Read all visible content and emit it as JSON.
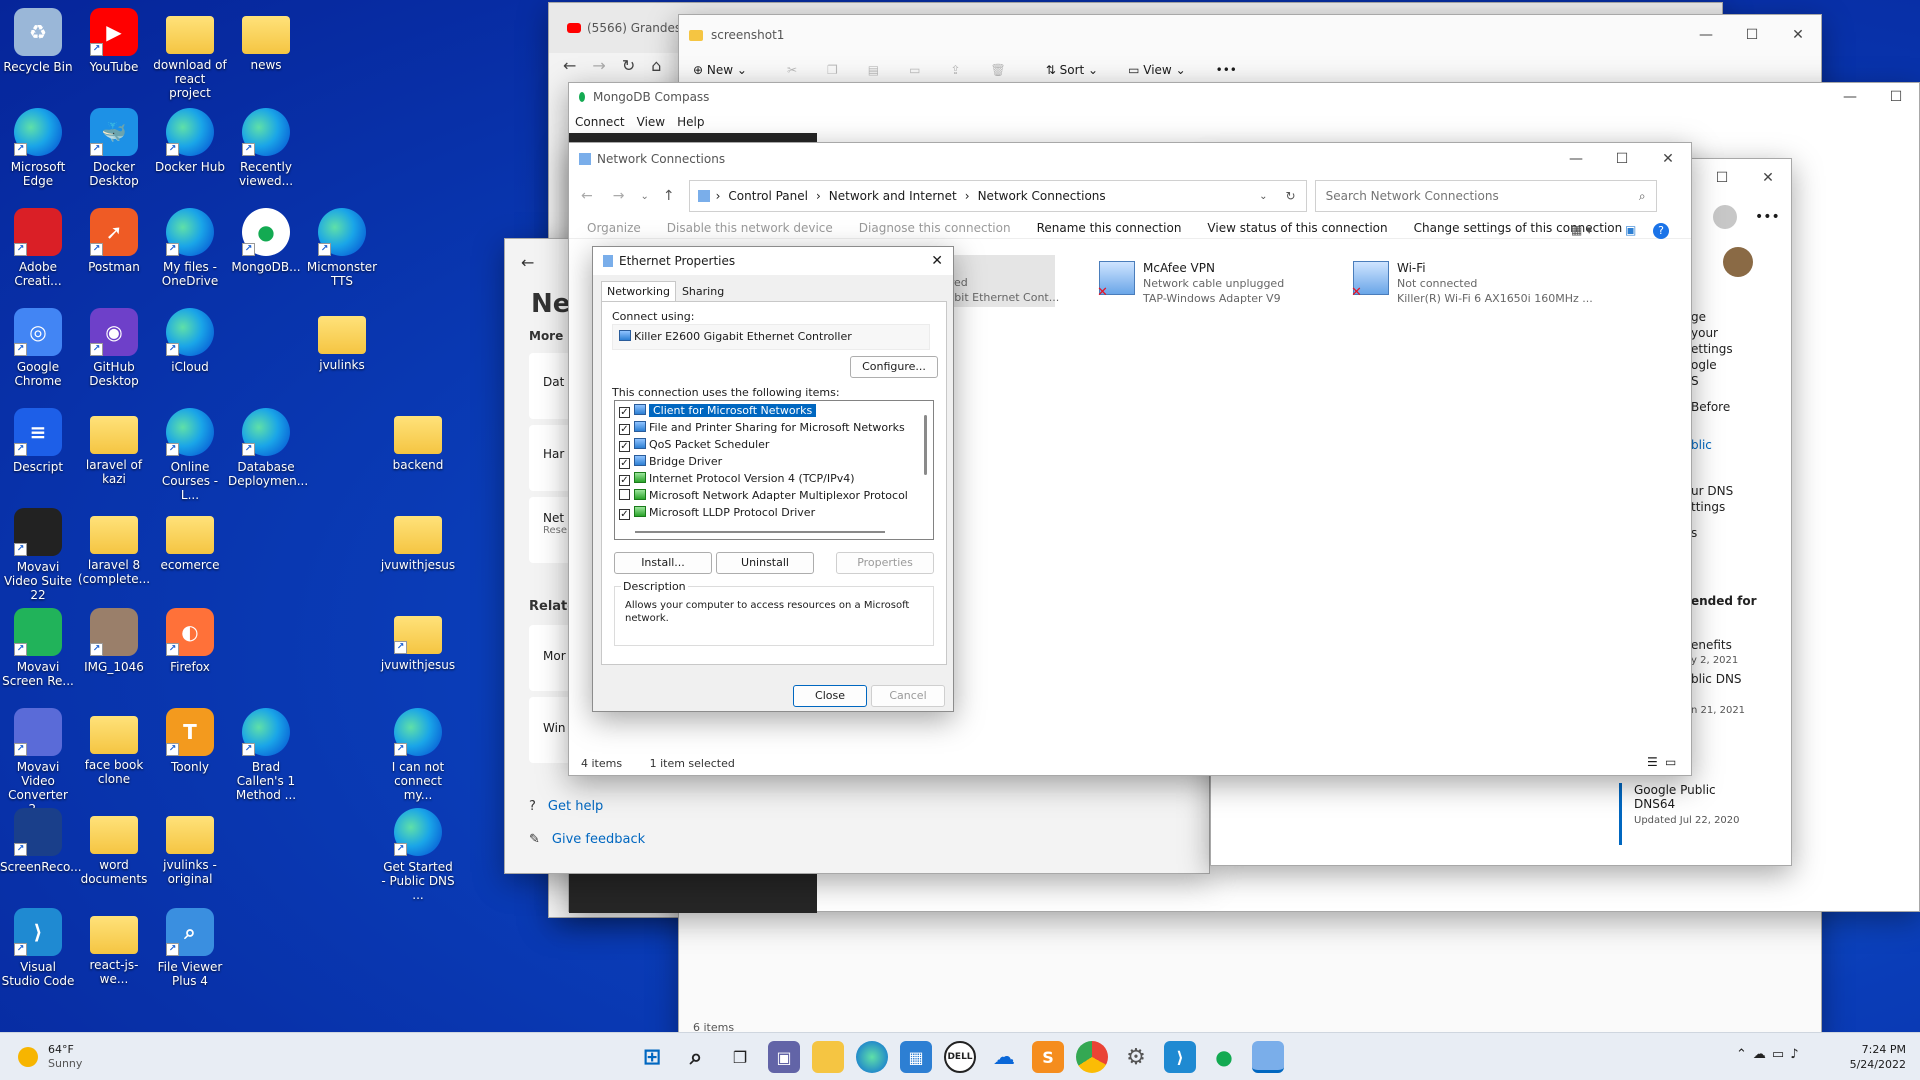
{
  "desktop": {
    "icons": [
      {
        "label": "Recycle Bin",
        "icon": "recycle-bin-icon"
      },
      {
        "label": "YouTube",
        "icon": "youtube-icon"
      },
      {
        "label": "download of react project",
        "icon": "folder-icon"
      },
      {
        "label": "news",
        "icon": "folder-icon"
      },
      {
        "label": "Microsoft Edge",
        "icon": "edge-icon"
      },
      {
        "label": "Docker Desktop",
        "icon": "docker-icon"
      },
      {
        "label": "Docker Hub",
        "icon": "edge-icon"
      },
      {
        "label": "Recently viewed...",
        "icon": "edge-icon"
      },
      {
        "label": "Adobe Creati...",
        "icon": "adobe-icon"
      },
      {
        "label": "Postman",
        "icon": "postman-icon"
      },
      {
        "label": "My files - OneDrive",
        "icon": "edge-icon"
      },
      {
        "label": "MongoDB...",
        "icon": "mongodb-icon"
      },
      {
        "label": "Micmonster TTS",
        "icon": "edge-icon"
      },
      {
        "label": "Google Chrome",
        "icon": "chrome-icon"
      },
      {
        "label": "GitHub Desktop",
        "icon": "github-icon"
      },
      {
        "label": "iCloud",
        "icon": "edge-icon"
      },
      {
        "label": "jvulinks",
        "icon": "folder-icon"
      },
      {
        "label": "Descript",
        "icon": "descript-icon"
      },
      {
        "label": "laravel of kazi",
        "icon": "folder-icon"
      },
      {
        "label": "Online Courses - L...",
        "icon": "edge-icon"
      },
      {
        "label": "Database Deploymen...",
        "icon": "edge-icon"
      },
      {
        "label": "backend",
        "icon": "folder-icon"
      },
      {
        "label": "Movavi Video Suite 22",
        "icon": "movavi-icon"
      },
      {
        "label": "laravel 8 (complete...",
        "icon": "folder-icon"
      },
      {
        "label": "ecomerce",
        "icon": "folder-icon"
      },
      {
        "label": "jvuwithjesus",
        "icon": "folder-icon"
      },
      {
        "label": "Movavi Screen Re...",
        "icon": "movavi-screen-icon"
      },
      {
        "label": "IMG_1046",
        "icon": "image-icon"
      },
      {
        "label": "Firefox",
        "icon": "firefox-icon"
      },
      {
        "label": "jvuwithjesus",
        "icon": "zip-folder-icon"
      },
      {
        "label": "Movavi Video Converter 2...",
        "icon": "movavi-converter-icon"
      },
      {
        "label": "face book clone",
        "icon": "folder-icon"
      },
      {
        "label": "Toonly",
        "icon": "toonly-icon"
      },
      {
        "label": "Brad Callen's 1 Method ...",
        "icon": "edge-icon"
      },
      {
        "label": "I can not connect my...",
        "icon": "edge-icon"
      },
      {
        "label": "ScreenReco...",
        "icon": "screenrec-icon"
      },
      {
        "label": "word documents",
        "icon": "folder-icon"
      },
      {
        "label": "jvulinks - original",
        "icon": "folder-icon"
      },
      {
        "label": "Get Started - Public DNS ...",
        "icon": "edge-icon"
      },
      {
        "label": "Visual Studio Code",
        "icon": "vscode-icon"
      },
      {
        "label": "react-js-we...",
        "icon": "folder-icon"
      },
      {
        "label": "File Viewer Plus 4",
        "icon": "fileviewer-icon"
      }
    ]
  },
  "browser_bg": {
    "tab_title": "(5566) Grandes"
  },
  "explorer_bg": {
    "title": "screenshot1",
    "new_label": "New",
    "sort_label": "Sort",
    "view_label": "View",
    "status": "6 items"
  },
  "mongodb": {
    "title": "MongoDB Compass",
    "menu": [
      "Connect",
      "View",
      "Help"
    ]
  },
  "settings_bg": {
    "page_title_fragment": "Ne",
    "more_fragment": "More s",
    "items": [
      "Dat",
      "Har",
      "Net",
      "Rese"
    ],
    "related": "Relate",
    "related_items": [
      "Mor",
      "Win"
    ],
    "get_help": "Get help",
    "give_feedback": "Give feedback"
  },
  "edge_bg": {
    "right_fragments": [
      "ge",
      "your",
      "ettings",
      "ogle",
      "S",
      "Before",
      "blic",
      "ur DNS",
      "ttings",
      "s",
      "ended for",
      "enefits",
      "y 2, 2021",
      "blic DNS",
      "n 21, 2021"
    ],
    "card_title": "Google Public DNS64",
    "card_date": "Updated Jul 22, 2020"
  },
  "netconn": {
    "title": "Network Connections",
    "breadcrumb": [
      "Control Panel",
      "Network and Internet",
      "Network Connections"
    ],
    "search_placeholder": "Search Network Connections",
    "commands": [
      "Organize",
      "Disable this network device",
      "Diagnose this connection",
      "Rename this connection",
      "View status of this connection",
      "Change settings of this connection"
    ],
    "adapters": [
      {
        "name": "",
        "line1": "Shared",
        "line2": "Gigabit Ethernet Cont...",
        "selected": true
      },
      {
        "name": "McAfee VPN",
        "line1": "Network cable unplugged",
        "line2": "TAP-Windows Adapter V9",
        "selected": false
      },
      {
        "name": "Wi-Fi",
        "line1": "Not connected",
        "line2": "Killer(R) Wi-Fi 6 AX1650i 160MHz ...",
        "selected": false
      }
    ],
    "status_count": "4 items",
    "status_selected": "1 item selected"
  },
  "dialog": {
    "title": "Ethernet Properties",
    "tabs": [
      "Networking",
      "Sharing"
    ],
    "connect_using_label": "Connect using:",
    "adapter": "Killer E2600 Gigabit Ethernet Controller",
    "configure_label": "Configure...",
    "items_label": "This connection uses the following items:",
    "items": [
      {
        "label": "Client for Microsoft Networks",
        "checked": true,
        "selected": true,
        "icon": "network-client-icon"
      },
      {
        "label": "File and Printer Sharing for Microsoft Networks",
        "checked": true,
        "selected": false,
        "icon": "network-service-icon"
      },
      {
        "label": "QoS Packet Scheduler",
        "checked": true,
        "selected": false,
        "icon": "network-service-icon"
      },
      {
        "label": "Bridge Driver",
        "checked": true,
        "selected": false,
        "icon": "network-service-icon"
      },
      {
        "label": "Internet Protocol Version 4 (TCP/IPv4)",
        "checked": true,
        "selected": false,
        "icon": "protocol-icon"
      },
      {
        "label": "Microsoft Network Adapter Multiplexor Protocol",
        "checked": false,
        "selected": false,
        "icon": "protocol-icon"
      },
      {
        "label": "Microsoft LLDP Protocol Driver",
        "checked": true,
        "selected": false,
        "icon": "protocol-icon"
      }
    ],
    "install_label": "Install...",
    "uninstall_label": "Uninstall",
    "properties_label": "Properties",
    "description_label": "Description",
    "description_text": "Allows your computer to access resources on a Microsoft network.",
    "close_label": "Close",
    "cancel_label": "Cancel"
  },
  "taskbar": {
    "weather_temp": "64°F",
    "weather_desc": "Sunny",
    "time": "7:24 PM",
    "date": "5/24/2022",
    "accent": "#0067c0"
  }
}
